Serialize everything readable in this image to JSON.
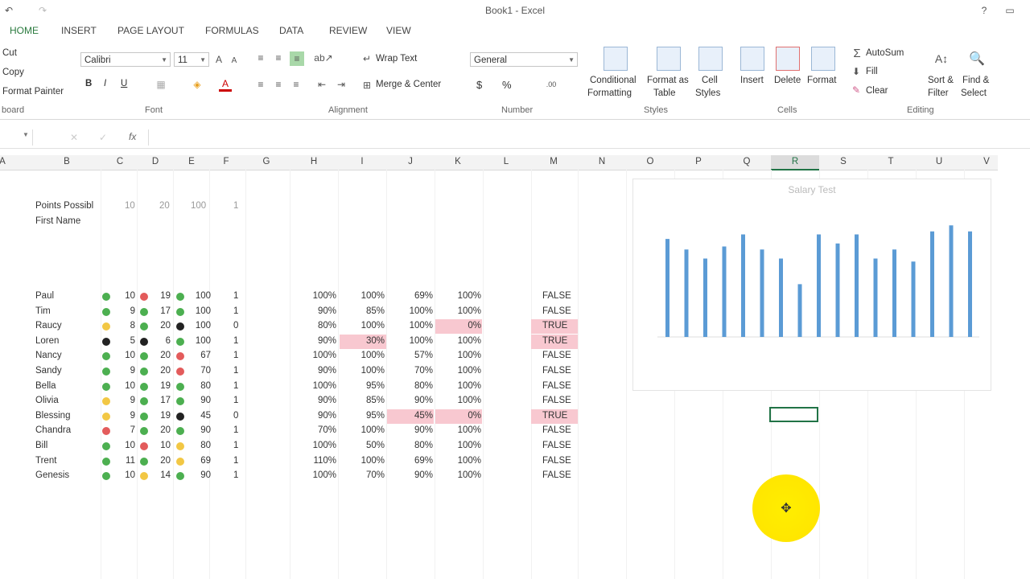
{
  "window": {
    "title": "Book1 - Excel"
  },
  "tabs": [
    "HOME",
    "INSERT",
    "PAGE LAYOUT",
    "FORMULAS",
    "DATA",
    "REVIEW",
    "VIEW"
  ],
  "ribbon": {
    "clipboard": {
      "cut": "Cut",
      "copy": "Copy",
      "format_painter": "Format Painter",
      "label": "board"
    },
    "font": {
      "name": "Calibri",
      "size": "11",
      "label": "Font",
      "bold": "B",
      "italic": "I",
      "underline": "U"
    },
    "alignment": {
      "wrap": "Wrap Text",
      "merge": "Merge & Center",
      "label": "Alignment"
    },
    "number": {
      "format": "General",
      "currency": "$",
      "percent": "%",
      "label": "Number"
    },
    "styles": {
      "conditional": "Conditional",
      "conditional2": "Formatting",
      "format_table": "Format as",
      "format_table2": "Table",
      "cell_styles": "Cell",
      "cell_styles2": "Styles",
      "label": "Styles"
    },
    "cells": {
      "insert": "Insert",
      "delete": "Delete",
      "format": "Format",
      "label": "Cells"
    },
    "editing": {
      "autosum": "AutoSum",
      "fill": "Fill",
      "clear": "Clear",
      "sort": "Sort &",
      "sort2": "Filter",
      "find": "Find &",
      "find2": "Select",
      "label": "Editing"
    }
  },
  "formula_bar": {
    "fx": "fx"
  },
  "columns": [
    "A",
    "B",
    "C",
    "D",
    "E",
    "F",
    "G",
    "H",
    "I",
    "J",
    "K",
    "L",
    "M",
    "N",
    "O",
    "P",
    "Q",
    "R",
    "S",
    "T",
    "U",
    "V"
  ],
  "selected_column": "R",
  "colors": {
    "green": "#4caf50",
    "yellow": "#f2c744",
    "red": "#e35b5b",
    "black": "#222222",
    "pink": "#f8c8d0",
    "bar": "#5b9bd5",
    "accent": "#217346"
  },
  "sheet": {
    "points_label": "Points Possibl",
    "first_name_label": "First Name",
    "points": [
      "10",
      "20",
      "100",
      "1"
    ],
    "rows": [
      {
        "name": "Paul",
        "c": "10",
        "cd": "green",
        "d": "19",
        "dd": "red",
        "e": "100",
        "ed": "green",
        "f": "1",
        "h": "100%",
        "i": "100%",
        "j": "69%",
        "k": "100%",
        "m": "FALSE",
        "ipink": false,
        "jpink": false,
        "kpink": false,
        "mpink": false
      },
      {
        "name": "Tim",
        "c": "9",
        "cd": "green",
        "d": "17",
        "dd": "green",
        "e": "100",
        "ed": "green",
        "f": "1",
        "h": "90%",
        "i": "85%",
        "j": "100%",
        "k": "100%",
        "m": "FALSE",
        "ipink": false,
        "jpink": false,
        "kpink": false,
        "mpink": false
      },
      {
        "name": "Raucy",
        "c": "8",
        "cd": "yellow",
        "d": "20",
        "dd": "green",
        "e": "100",
        "ed": "black",
        "f": "0",
        "h": "80%",
        "i": "100%",
        "j": "100%",
        "k": "0%",
        "m": "TRUE",
        "ipink": false,
        "jpink": false,
        "kpink": true,
        "mpink": true
      },
      {
        "name": "Loren",
        "c": "5",
        "cd": "black",
        "d": "6",
        "dd": "black",
        "e": "100",
        "ed": "green",
        "f": "1",
        "h": "90%",
        "i": "30%",
        "j": "100%",
        "k": "100%",
        "m": "TRUE",
        "ipink": true,
        "jpink": false,
        "kpink": false,
        "mpink": true
      },
      {
        "name": "Nancy",
        "c": "10",
        "cd": "green",
        "d": "20",
        "dd": "green",
        "e": "67",
        "ed": "red",
        "f": "1",
        "h": "100%",
        "i": "100%",
        "j": "57%",
        "k": "100%",
        "m": "FALSE",
        "ipink": false,
        "jpink": false,
        "kpink": false,
        "mpink": false
      },
      {
        "name": "Sandy",
        "c": "9",
        "cd": "green",
        "d": "20",
        "dd": "green",
        "e": "70",
        "ed": "red",
        "f": "1",
        "h": "90%",
        "i": "100%",
        "j": "70%",
        "k": "100%",
        "m": "FALSE",
        "ipink": false,
        "jpink": false,
        "kpink": false,
        "mpink": false
      },
      {
        "name": "Bella",
        "c": "10",
        "cd": "green",
        "d": "19",
        "dd": "green",
        "e": "80",
        "ed": "green",
        "f": "1",
        "h": "100%",
        "i": "95%",
        "j": "80%",
        "k": "100%",
        "m": "FALSE",
        "ipink": false,
        "jpink": false,
        "kpink": false,
        "mpink": false
      },
      {
        "name": "Olivia",
        "c": "9",
        "cd": "yellow",
        "d": "17",
        "dd": "green",
        "e": "90",
        "ed": "green",
        "f": "1",
        "h": "90%",
        "i": "85%",
        "j": "90%",
        "k": "100%",
        "m": "FALSE",
        "ipink": false,
        "jpink": false,
        "kpink": false,
        "mpink": false
      },
      {
        "name": "Blessing",
        "c": "9",
        "cd": "yellow",
        "d": "19",
        "dd": "green",
        "e": "45",
        "ed": "black",
        "f": "0",
        "h": "90%",
        "i": "95%",
        "j": "45%",
        "k": "0%",
        "m": "TRUE",
        "ipink": false,
        "jpink": true,
        "kpink": true,
        "mpink": true
      },
      {
        "name": "Chandra",
        "c": "7",
        "cd": "red",
        "d": "20",
        "dd": "green",
        "e": "90",
        "ed": "green",
        "f": "1",
        "h": "70%",
        "i": "100%",
        "j": "90%",
        "k": "100%",
        "m": "FALSE",
        "ipink": false,
        "jpink": false,
        "kpink": false,
        "mpink": false
      },
      {
        "name": "Bill",
        "c": "10",
        "cd": "green",
        "d": "10",
        "dd": "red",
        "e": "80",
        "ed": "yellow",
        "f": "1",
        "h": "100%",
        "i": "50%",
        "j": "80%",
        "k": "100%",
        "m": "FALSE",
        "ipink": false,
        "jpink": false,
        "kpink": false,
        "mpink": false
      },
      {
        "name": "Trent",
        "c": "11",
        "cd": "green",
        "d": "20",
        "dd": "green",
        "e": "69",
        "ed": "yellow",
        "f": "1",
        "h": "110%",
        "i": "100%",
        "j": "69%",
        "k": "100%",
        "m": "FALSE",
        "ipink": false,
        "jpink": false,
        "kpink": false,
        "mpink": false
      },
      {
        "name": "Genesis",
        "c": "10",
        "cd": "green",
        "d": "14",
        "dd": "yellow",
        "e": "90",
        "ed": "green",
        "f": "1",
        "h": "100%",
        "i": "70%",
        "j": "90%",
        "k": "100%",
        "m": "FALSE",
        "ipink": false,
        "jpink": false,
        "kpink": false,
        "mpink": false
      }
    ]
  },
  "chart_data": {
    "type": "bar",
    "title": "Salary Test",
    "values": [
      65,
      58,
      52,
      60,
      68,
      58,
      52,
      35,
      68,
      62,
      68,
      52,
      58,
      50,
      70,
      74,
      70
    ]
  }
}
